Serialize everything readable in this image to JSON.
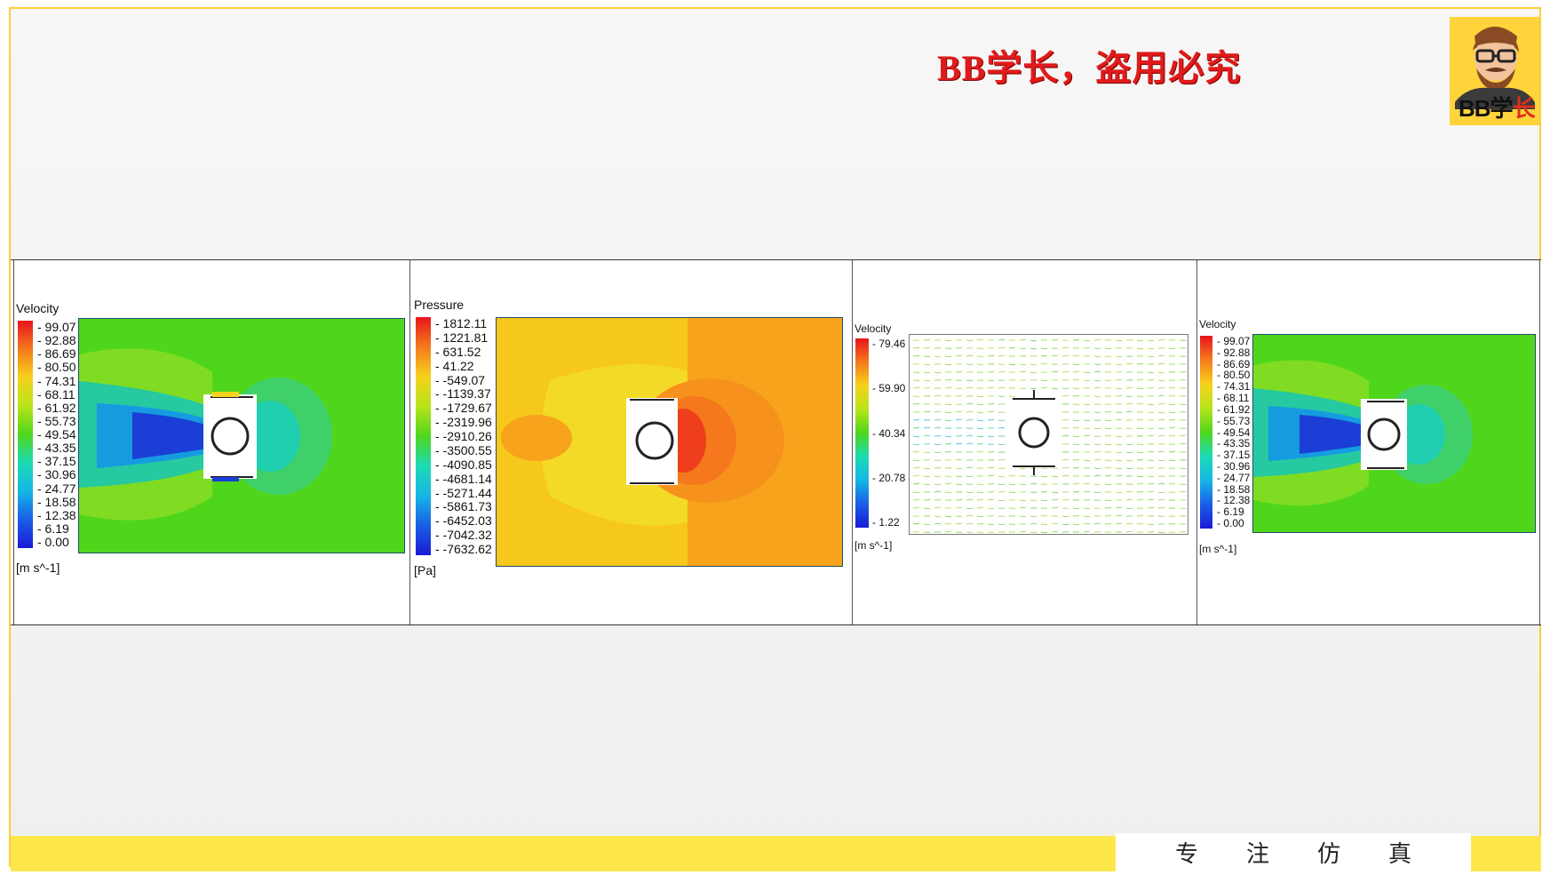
{
  "watermark": "BB学长，盗用必究",
  "avatar": {
    "label_black": "BB学",
    "label_red": "长"
  },
  "footer": {
    "chars": [
      "专",
      "注",
      "仿",
      "真"
    ]
  },
  "panels": [
    {
      "title": "Velocity",
      "unit": "[m s^-1]",
      "ticks": [
        "99.07",
        "92.88",
        "86.69",
        "80.50",
        "74.31",
        "68.11",
        "61.92",
        "55.73",
        "49.54",
        "43.35",
        "37.15",
        "30.96",
        "24.77",
        "18.58",
        "12.38",
        "6.19",
        "0.00"
      ],
      "field": "velocity-contour"
    },
    {
      "title": "Pressure",
      "unit": "[Pa]",
      "ticks": [
        "1812.11",
        "1221.81",
        "631.52",
        "41.22",
        "-549.07",
        "-1139.37",
        "-1729.67",
        "-2319.96",
        "-2910.26",
        "-3500.55",
        "-4090.85",
        "-4681.14",
        "-5271.44",
        "-5861.73",
        "-6452.03",
        "-7042.32",
        "-7632.62"
      ],
      "field": "pressure-contour"
    },
    {
      "title": "Velocity",
      "unit": "[m s^-1]",
      "ticks": [
        "79.46",
        "59.90",
        "40.34",
        "20.78",
        "1.22"
      ],
      "field": "velocity-vector"
    },
    {
      "title": "Velocity",
      "unit": "[m s^-1]",
      "ticks": [
        "99.07",
        "92.88",
        "86.69",
        "80.50",
        "74.31",
        "68.11",
        "61.92",
        "55.73",
        "49.54",
        "43.35",
        "37.15",
        "30.96",
        "24.77",
        "18.58",
        "12.38",
        "6.19",
        "0.00"
      ],
      "field": "velocity-contour"
    }
  ]
}
